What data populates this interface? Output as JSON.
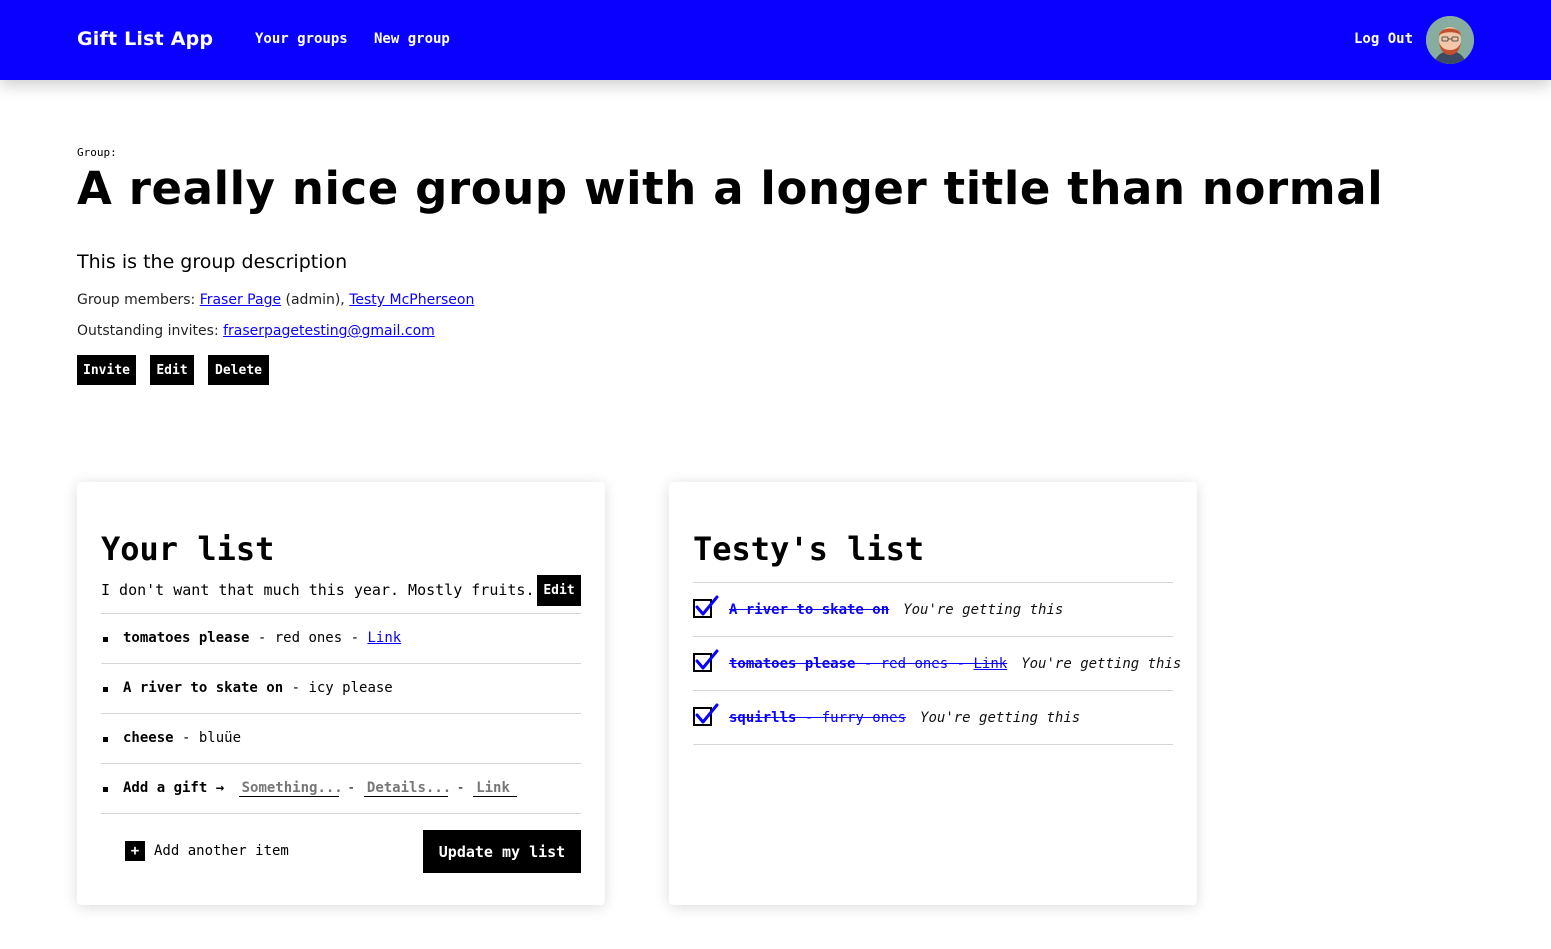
{
  "header": {
    "brand": "Gift List App",
    "nav": [
      "Your groups",
      "New group"
    ],
    "logout": "Log Out",
    "avatar_icon": "user-avatar",
    "bar_color": "#0a00ff"
  },
  "group": {
    "kicker": "Group:",
    "title": "A really nice group with a longer title than normal",
    "description": "This is the group description",
    "members_label": "Group members:",
    "members": [
      {
        "name": "Fraser Page",
        "suffix": " (admin),"
      },
      {
        "name": "Testy McPherseon",
        "suffix": ""
      }
    ],
    "invites_label": "Outstanding invites:",
    "invites": [
      "fraserpagetesting@gmail.com"
    ],
    "actions": [
      "Invite",
      "Edit",
      "Delete"
    ]
  },
  "your_list": {
    "title": "Your list",
    "note": "I don't want that much this year. Mostly fruits.",
    "edit_label": "Edit",
    "items": [
      {
        "name": "tomatoes please",
        "details": "red ones",
        "link": "Link"
      },
      {
        "name": "A river to skate on",
        "details": "icy please",
        "link": ""
      },
      {
        "name": "cheese",
        "details": "bluüe",
        "link": ""
      }
    ],
    "add": {
      "label": "Add a gift →",
      "name_placeholder": "Something...",
      "details_placeholder": "Details...",
      "link_placeholder": "Link"
    },
    "add_another": "Add another item",
    "update": "Update my list"
  },
  "other_list": {
    "title": "Testy's list",
    "items": [
      {
        "name": "A river to skate on",
        "details": "",
        "link": "",
        "status": "You're getting this",
        "checked": true
      },
      {
        "name": "tomatoes please",
        "details": "red ones",
        "link": "Link",
        "status": "You're getting this",
        "checked": true
      },
      {
        "name": "squirlls",
        "details": "furry ones",
        "link": "",
        "status": "You're getting this",
        "checked": true
      }
    ]
  }
}
